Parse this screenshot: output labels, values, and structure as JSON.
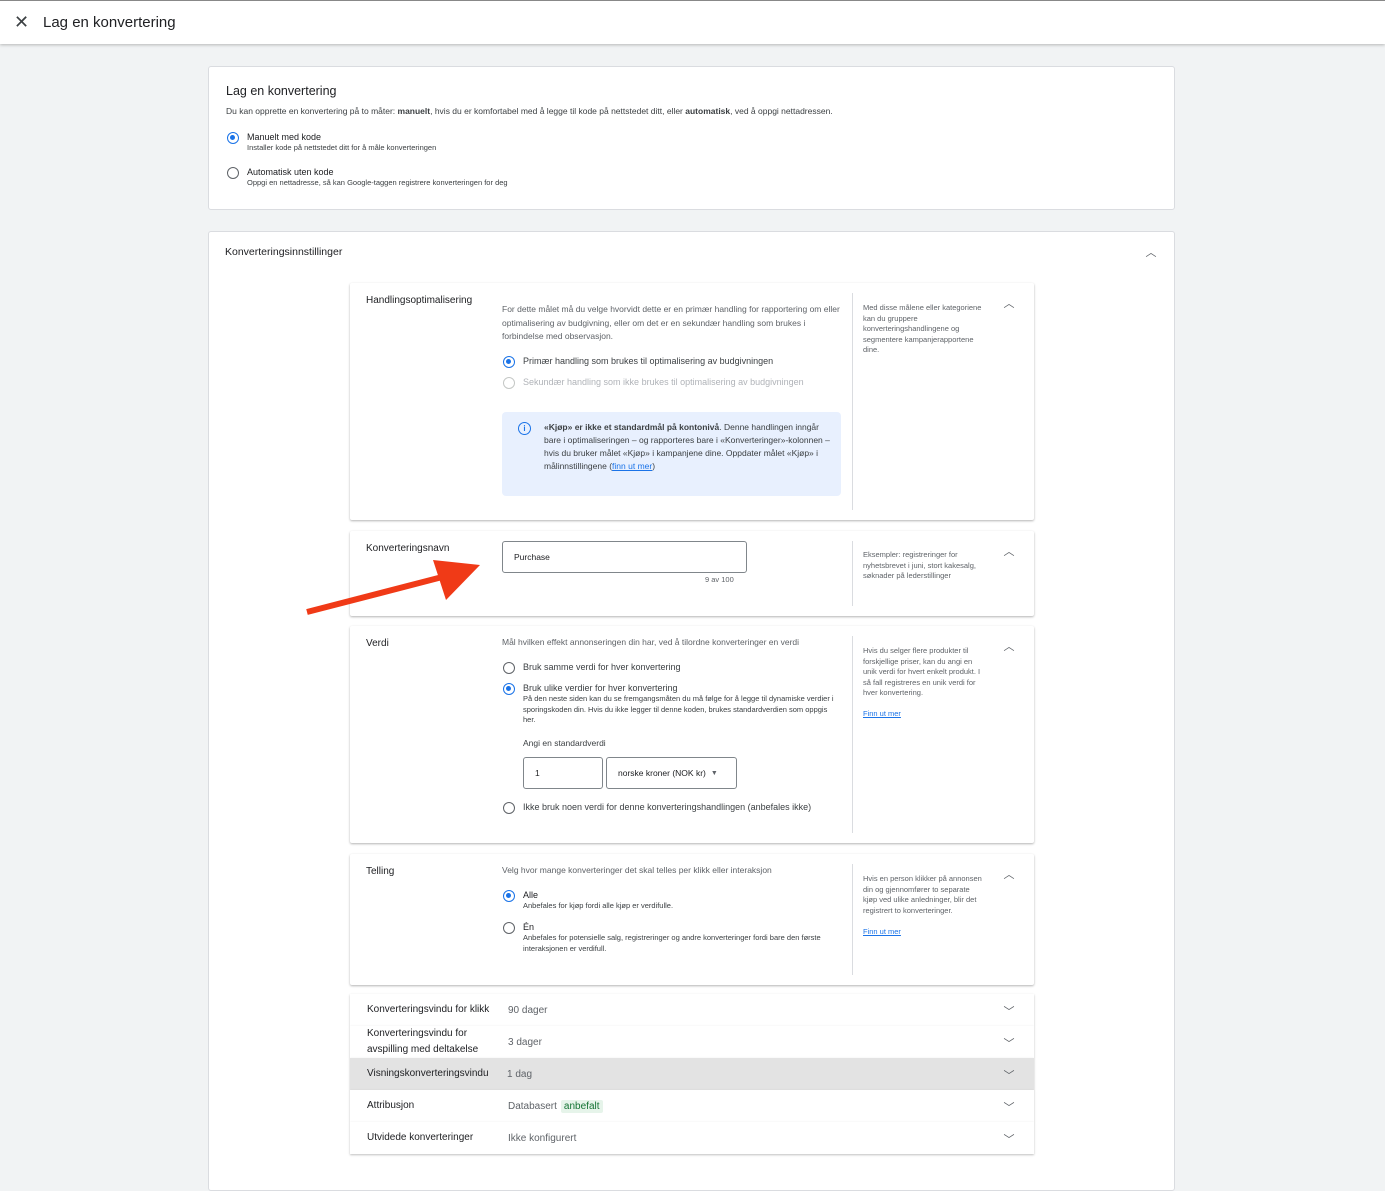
{
  "topbar": {
    "title": "Lag en konvertering"
  },
  "method": {
    "title": "Lag en konvertering",
    "desc_pre": "Du kan opprette en konvertering på to måter: ",
    "desc_b1": "manuelt",
    "desc_mid": ", hvis du er komfortabel med å legge til kode på nettstedet ditt, eller ",
    "desc_b2": "automatisk",
    "desc_post": ", ved å oppgi nettadressen.",
    "options": [
      {
        "label": "Manuelt med kode",
        "sub": "Installer kode på nettstedet ditt for å måle konverteringen",
        "selected": true
      },
      {
        "label": "Automatisk uten kode",
        "sub": "Oppgi en nettadresse, så kan Google-taggen registrere konverteringen for deg",
        "selected": false
      }
    ]
  },
  "settings": {
    "title": "Konverteringsinnstillinger",
    "action": {
      "label": "Handlingsoptimalisering",
      "desc": "For dette målet må du velge hvorvidt dette er en primær handling for rapportering om eller optimalisering av budgivning, eller om det er en sekundær handling som brukes i forbindelse med observasjon.",
      "options": [
        "Primær handling som brukes til optimalisering av budgivningen",
        "Sekundær handling som ikke brukes til optimalisering av budgivningen"
      ],
      "info_bold": "«Kjøp» er ikke et standardmål på kontonivå",
      "info_text": ". Denne handlingen inngår bare i optimaliseringen – og rapporteres bare i «Konverteringer»-kolonnen – hvis du bruker målet «Kjøp» i kampanjene dine. Oppdater målet «Kjøp» i målinnstillingene (",
      "info_link": "finn ut mer",
      "info_end": ")",
      "help": "Med disse målene eller kategoriene kan du gruppere konverteringshandlingene og segmentere kampanjerapportene dine."
    },
    "name": {
      "label": "Konverteringsnavn",
      "value": "Purchase",
      "counter": "9 av 100",
      "help": "Eksempler: registreringer for nyhetsbrevet i juni, stort kakesalg, søknader på lederstillinger"
    },
    "value": {
      "label": "Verdi",
      "desc": "Mål hvilken effekt annonseringen din har, ved å tilordne konverteringer en verdi",
      "opt1": "Bruk samme verdi for hver konvertering",
      "opt2": "Bruk ulike verdier for hver konvertering",
      "opt2_sub": "På den neste siden kan du se fremgangsmåten du må følge for å legge til dynamiske verdier i sporingskoden din. Hvis du ikke legger til denne koden, brukes standardverdien som oppgis her.",
      "default_label": "Angi en standardverdi",
      "default_value": "1",
      "currency": "norske kroner (NOK kr)",
      "opt3": "Ikke bruk noen verdi for denne konverteringshandlingen (anbefales ikke)",
      "help": "Hvis du selger flere produkter til forskjellige priser, kan du angi en unik verdi for hvert enkelt produkt. I så fall registreres en unik verdi for hver konvertering.",
      "help_link": "Finn ut mer"
    },
    "count": {
      "label": "Telling",
      "desc": "Velg hvor mange konverteringer det skal telles per klikk eller interaksjon",
      "opt1": "Alle",
      "opt1_sub": "Anbefales for kjøp fordi alle kjøp er verdifulle.",
      "opt2": "Én",
      "opt2_sub": "Anbefales for potensielle salg, registreringer og andre konverteringer fordi bare den første interaksjonen er verdifull.",
      "help": "Hvis en person klikker på annonsen din og gjennomfører to separate kjøp ved ulike anledninger, blir det registrert to konverteringer.",
      "help_link": "Finn ut mer"
    },
    "rows": [
      {
        "label": "Konverteringsvindu for klikk",
        "value": "90 dager"
      },
      {
        "label": "Konverteringsvindu for avspilling med deltakelse",
        "value": "3 dager"
      },
      {
        "label": "Visningskonverteringsvindu",
        "value": "1 dag"
      },
      {
        "label": "Attribusjon",
        "value": "Databasert",
        "badge": "anbefalt"
      },
      {
        "label": "Utvidede konverteringer",
        "value": "Ikke konfigurert"
      }
    ]
  },
  "colors": {
    "accent": "#1a73e8",
    "arrow": "#f03a17",
    "badge_bg": "#e6f4ea",
    "badge_fg": "#137333"
  }
}
